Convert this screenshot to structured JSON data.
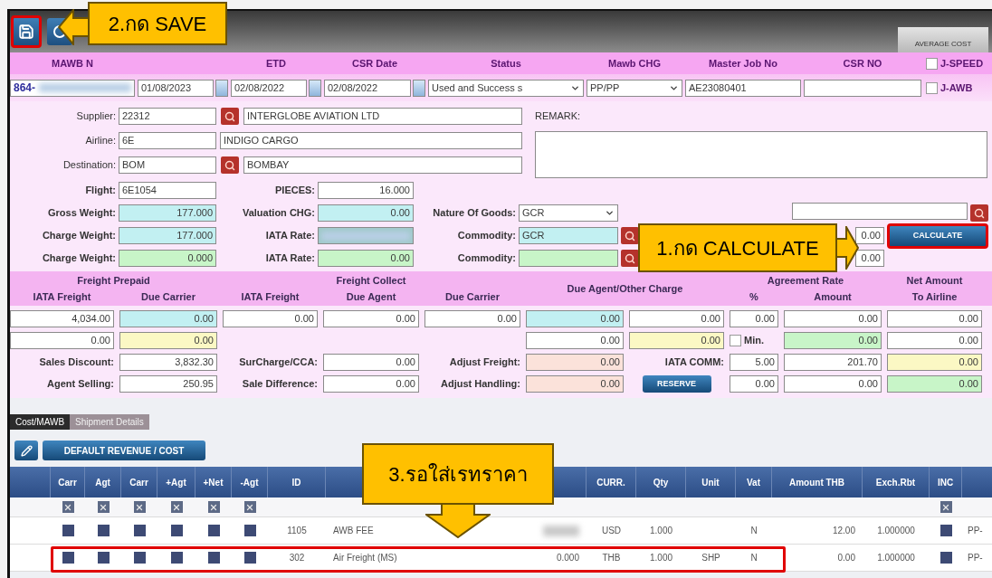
{
  "toolbar": {
    "save_button": {
      "highlighted": true
    },
    "average_cost_button": "AVERAGE COST"
  },
  "header": {
    "columns": [
      {
        "label": "MAWB N",
        "field": {
          "kind": "blurred",
          "value": "864-",
          "color": "#ffffff"
        }
      },
      {
        "field": {
          "kind": "date",
          "value": "01/08/2023"
        }
      },
      {
        "label": "ETD",
        "field": {
          "kind": "date",
          "value": "02/08/2022"
        }
      },
      {
        "label": "CSR Date",
        "field": {
          "kind": "date",
          "value": "02/08/2022"
        }
      },
      {
        "label": "Status",
        "field": {
          "kind": "select",
          "value": "Used and Success s"
        }
      },
      {
        "label": "Mawb CHG",
        "field": {
          "kind": "select",
          "value": "PP/PP"
        }
      },
      {
        "label": "Master Job No",
        "field": {
          "kind": "text",
          "value": "AE23080401"
        }
      },
      {
        "label": "CSR NO",
        "field": {
          "kind": "text"
        }
      }
    ],
    "checkboxes": [
      {
        "label": "J-SPEED",
        "checked": false
      },
      {
        "label": "J-AWB",
        "checked": false
      }
    ]
  },
  "parties": [
    {
      "label": "Supplier:",
      "code": "22312",
      "search": true,
      "name": "INTERGLOBE AVIATION LTD"
    },
    {
      "label": "Airline:",
      "code": "6E",
      "search": false,
      "name": "INDIGO CARGO"
    },
    {
      "label": "Destination:",
      "code": "BOM",
      "search": true,
      "name": "BOMBAY"
    }
  ],
  "remark": {
    "label": "REMARK:"
  },
  "shipment_rows": [
    [
      {
        "label": "Flight:",
        "field": {
          "kind": "text",
          "value": "6E1054",
          "color": "#ffffff"
        }
      },
      {
        "label": "PIECES:",
        "field": {
          "kind": "number",
          "value": "16.000",
          "color": "#ffffff"
        }
      }
    ],
    [
      {
        "label": "Gross Weight:",
        "field": {
          "kind": "number",
          "value": "177.000",
          "color": "#c2f0f2"
        }
      },
      {
        "label": "Valuation CHG:",
        "field": {
          "kind": "number",
          "value": "0.00",
          "color": "#c2f0f2"
        }
      },
      {
        "label": "Nature Of Goods:",
        "field": {
          "kind": "select",
          "value": "GCR",
          "color": "#ffffff"
        }
      },
      {
        "field": {
          "kind": "text",
          "color": "#ffffff"
        },
        "search": true
      }
    ],
    [
      {
        "label": "Charge Weight:",
        "field": {
          "kind": "number",
          "value": "177.000",
          "color": "#c2f0f2"
        }
      },
      {
        "label": "IATA Rate:",
        "field": {
          "kind": "blurred",
          "color": "#9fc9c9"
        }
      },
      {
        "label": "Commodity:",
        "field": {
          "kind": "text",
          "value": "GCR",
          "color": "#c2f0f2"
        },
        "search": true
      },
      {
        "field": {
          "kind": "number",
          "value": "0.00",
          "color": "#ffffff"
        },
        "button": {
          "label": "CALCULATE",
          "highlighted": true
        }
      }
    ],
    [
      {
        "label": "Charge Weight:",
        "field": {
          "kind": "number",
          "value": "0.000",
          "color": "#c8f5c8"
        }
      },
      {
        "label": "IATA Rate:",
        "field": {
          "kind": "number",
          "value": "0.00",
          "color": "#c8f5c8"
        }
      },
      {
        "label": "Commodity:",
        "field": {
          "kind": "text",
          "color": "#c8f5c8"
        },
        "search": true
      },
      {
        "field": {
          "kind": "number",
          "value": "0.00",
          "color": "#ffffff"
        }
      }
    ]
  ],
  "freight": {
    "header_top": [
      "Freight Prepaid",
      "Freight Collect",
      "Agreement Rate",
      "Net Amount"
    ],
    "header_bottom": [
      "IATA Freight",
      "Due Carrier",
      "IATA Freight",
      "Due Agent",
      "Due Carrier",
      "Due Agent/Other Charge",
      "%",
      "Amount",
      "To Airline"
    ],
    "rows": [
      [
        {
          "kind": "field",
          "value": "4,034.00",
          "color": "#ffffff"
        },
        {
          "kind": "field",
          "value": "0.00",
          "color": "#c2f0f2"
        },
        {
          "kind": "field",
          "value": "0.00",
          "color": "#ffffff"
        },
        {
          "kind": "field",
          "value": "0.00",
          "color": "#ffffff"
        },
        {
          "kind": "field",
          "value": "0.00",
          "color": "#ffffff"
        },
        {
          "kind": "field",
          "value": "0.00",
          "color": "#c2f0f2"
        },
        {
          "kind": "field",
          "value": "0.00",
          "color": "#ffffff"
        },
        {
          "kind": "field",
          "value": "0.00",
          "color": "#ffffff"
        },
        {
          "kind": "field",
          "value": "0.00",
          "color": "#ffffff"
        },
        {
          "kind": "field",
          "value": "0.00",
          "color": "#ffffff"
        }
      ],
      [
        {
          "kind": "field",
          "value": "0.00",
          "color": "#ffffff"
        },
        {
          "kind": "field",
          "value": "0.00",
          "color": "#fbf8c4"
        },
        {
          "kind": "empty"
        },
        {
          "kind": "empty"
        },
        {
          "kind": "empty"
        },
        {
          "kind": "field",
          "value": "0.00",
          "color": "#ffffff"
        },
        {
          "kind": "field",
          "value": "0.00",
          "color": "#fbf8c4"
        },
        {
          "kind": "checkbox",
          "label": "Min.",
          "checked": false
        },
        {
          "kind": "field",
          "value": "0.00",
          "color": "#c8f5c8"
        },
        {
          "kind": "field",
          "value": "0.00",
          "color": "#ffffff"
        }
      ],
      [
        {
          "kind": "label",
          "text": "Sales Discount:"
        },
        {
          "kind": "field",
          "value": "3,832.30",
          "color": "#ffffff"
        },
        {
          "kind": "label",
          "text": "SurCharge/CCA:"
        },
        {
          "kind": "field",
          "value": "0.00",
          "color": "#ffffff"
        },
        {
          "kind": "label",
          "text": "Adjust Freight:"
        },
        {
          "kind": "field",
          "value": "0.00",
          "color": "#fbe2da"
        },
        {
          "kind": "label",
          "text": "IATA COMM:"
        },
        {
          "kind": "field",
          "value": "5.00",
          "color": "#ffffff"
        },
        {
          "kind": "field",
          "value": "201.70",
          "color": "#ffffff"
        },
        {
          "kind": "field",
          "value": "0.00",
          "color": "#fbf8c4"
        }
      ],
      [
        {
          "kind": "label",
          "text": "Agent Selling:"
        },
        {
          "kind": "field",
          "value": "250.95",
          "color": "#ffffff"
        },
        {
          "kind": "label",
          "text": "Sale Difference:"
        },
        {
          "kind": "field",
          "value": "0.00",
          "color": "#ffffff"
        },
        {
          "kind": "label",
          "text": "Adjust Handling:"
        },
        {
          "kind": "field",
          "value": "0.00",
          "color": "#fbe2da"
        },
        {
          "kind": "button",
          "label": "RESERVE"
        },
        {
          "kind": "field",
          "value": "0.00",
          "color": "#ffffff"
        },
        {
          "kind": "field",
          "value": "0.00",
          "color": "#ffffff"
        },
        {
          "kind": "field",
          "value": "0.00",
          "color": "#c8f5c8"
        }
      ]
    ]
  },
  "tabs": [
    {
      "label": "Cost/MAWB",
      "selected": true
    },
    {
      "label": "Shipment Details",
      "selected": false
    }
  ],
  "default_button": "DEFAULT REVENUE / COST",
  "table": {
    "columns": [
      null,
      "Carr",
      "Agt",
      "Carr",
      "+Agt",
      "+Net",
      "-Agt",
      "ID",
      null,
      null,
      "CURR.",
      "Qty",
      "Unit",
      "Vat",
      "Amount THB",
      "Exch.Rbt",
      "INC",
      null
    ],
    "rows": [
      {
        "kind": "filter",
        "highlighted": false,
        "checks": [
          true,
          true,
          true,
          true,
          true,
          true,
          true
        ]
      },
      {
        "kind": "item",
        "highlighted": false,
        "checks": [
          true,
          true,
          true,
          true,
          true,
          true,
          true
        ],
        "id": "1105",
        "description": "AWB FEE",
        "column_9_blurred": true,
        "curr": "USD",
        "qty": "1.000",
        "vat": "N",
        "amount_thb": "12.00",
        "exch_rate": "1.000000",
        "column_17": "PP-"
      },
      {
        "kind": "item",
        "highlighted": true,
        "checks": [
          true,
          true,
          true,
          true,
          true,
          true,
          true
        ],
        "id": "302",
        "description": "Air Freight (MS)",
        "column_9": "0.000",
        "curr": "THB",
        "qty": "1.000",
        "unit": "SHP",
        "vat": "N",
        "amount_thb": "0.00",
        "exch_rate": "1.000000",
        "column_17": "PP-"
      }
    ]
  },
  "callouts": [
    {
      "text": "2.กด SAVE",
      "kind": "left"
    },
    {
      "text": "1.กด CALCULATE",
      "kind": "right"
    },
    {
      "text": "3.รอใส่เรทราคา",
      "kind": "down"
    }
  ]
}
